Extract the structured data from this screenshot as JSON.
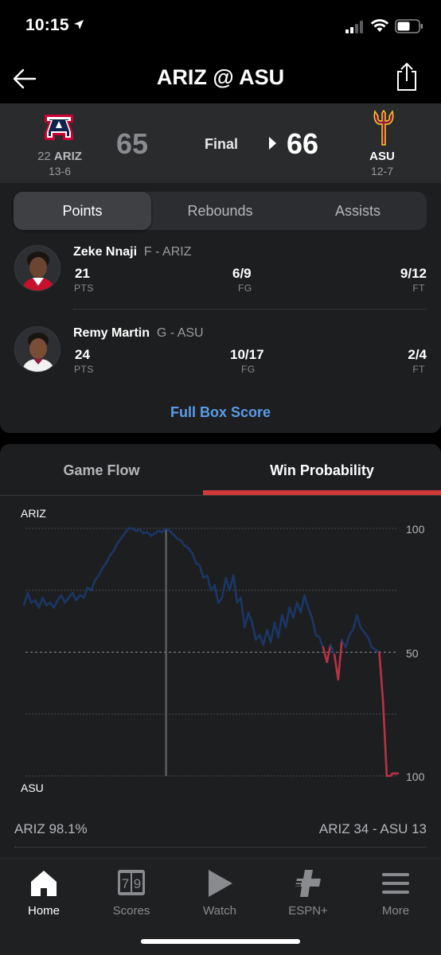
{
  "status_bar": {
    "time": "10:15"
  },
  "nav": {
    "title": "ARIZ @ ASU"
  },
  "game": {
    "away": {
      "rank": "22",
      "abbr": "ARIZ",
      "record": "13-6",
      "score": "65",
      "color": "#cc0033",
      "logo_color": "#0c234b"
    },
    "home": {
      "abbr": "ASU",
      "record": "12-7",
      "score": "66",
      "color": "#8c1d40",
      "logo_color": "#ffc627"
    },
    "status": "Final"
  },
  "leaders": {
    "tabs": [
      {
        "label": "Points",
        "active": true
      },
      {
        "label": "Rebounds",
        "active": false
      },
      {
        "label": "Assists",
        "active": false
      }
    ],
    "players": [
      {
        "name": "Zeke Nnaji",
        "meta": "F - ARIZ",
        "stats": [
          {
            "value": "21",
            "label": "PTS"
          },
          {
            "value": "6/9",
            "label": "FG"
          },
          {
            "value": "9/12",
            "label": "FT"
          }
        ]
      },
      {
        "name": "Remy Martin",
        "meta": "G - ASU",
        "stats": [
          {
            "value": "24",
            "label": "PTS"
          },
          {
            "value": "10/17",
            "label": "FG"
          },
          {
            "value": "2/4",
            "label": "FT"
          }
        ]
      }
    ],
    "full_box_score": "Full Box Score"
  },
  "flow": {
    "tabs": [
      {
        "label": "Game Flow",
        "active": false
      },
      {
        "label": "Win Probability",
        "active": true
      }
    ],
    "footer_left": "ARIZ 98.1%",
    "footer_right": "ARIZ 34  - ASU 13"
  },
  "chart_data": {
    "type": "line",
    "top_label": "ARIZ",
    "bottom_label": "ASU",
    "y_tick_labels": [
      "100",
      "50",
      "100"
    ],
    "ylim": [
      -100,
      100
    ],
    "y_meaning": "ARIZ win probability margin (positive = ARIZ favored)",
    "marker_fraction": 0.38,
    "series": [
      {
        "colors": {
          "ariz": "#1b3766",
          "asu": "#b83245"
        },
        "x": [
          0,
          0.01,
          0.02,
          0.03,
          0.04,
          0.05,
          0.06,
          0.07,
          0.08,
          0.09,
          0.1,
          0.11,
          0.12,
          0.13,
          0.14,
          0.15,
          0.16,
          0.17,
          0.18,
          0.19,
          0.2,
          0.21,
          0.22,
          0.23,
          0.24,
          0.25,
          0.26,
          0.27,
          0.28,
          0.29,
          0.3,
          0.31,
          0.32,
          0.33,
          0.34,
          0.35,
          0.36,
          0.37,
          0.38,
          0.39,
          0.4,
          0.41,
          0.42,
          0.43,
          0.44,
          0.45,
          0.46,
          0.47,
          0.48,
          0.49,
          0.5,
          0.51,
          0.52,
          0.53,
          0.54,
          0.55,
          0.56,
          0.57,
          0.58,
          0.59,
          0.6,
          0.61,
          0.62,
          0.63,
          0.64,
          0.65,
          0.66,
          0.67,
          0.68,
          0.69,
          0.7,
          0.71,
          0.72,
          0.73,
          0.74,
          0.75,
          0.76,
          0.77,
          0.78,
          0.79,
          0.8,
          0.81,
          0.82,
          0.83,
          0.84,
          0.85,
          0.86,
          0.87,
          0.88,
          0.89,
          0.9,
          0.91,
          0.92,
          0.93,
          0.94,
          0.95,
          0.96,
          0.97,
          0.98,
          0.985,
          0.99,
          0.995,
          1.0
        ],
        "values": [
          38,
          48,
          40,
          42,
          36,
          44,
          38,
          40,
          36,
          42,
          46,
          40,
          44,
          48,
          42,
          46,
          44,
          52,
          50,
          58,
          62,
          68,
          72,
          78,
          82,
          88,
          92,
          96,
          100,
          100,
          98,
          99,
          96,
          97,
          94,
          96,
          98,
          97,
          100,
          98,
          95,
          92,
          90,
          86,
          84,
          80,
          72,
          70,
          60,
          62,
          50,
          54,
          40,
          44,
          60,
          50,
          62,
          40,
          44,
          20,
          32,
          24,
          10,
          14,
          6,
          18,
          8,
          24,
          12,
          30,
          20,
          36,
          28,
          40,
          32,
          46,
          36,
          28,
          14,
          12,
          4,
          -8,
          6,
          -2,
          -22,
          10,
          4,
          14,
          18,
          30,
          20,
          16,
          12,
          4,
          2,
          0,
          -40,
          -100,
          -100,
          -98,
          -98,
          -98,
          -98
        ]
      }
    ]
  },
  "tab_bar": {
    "items": [
      {
        "label": "Home",
        "icon": "home-icon",
        "active": true
      },
      {
        "label": "Scores",
        "icon": "scores-icon",
        "active": false,
        "icon_text": "79"
      },
      {
        "label": "Watch",
        "icon": "play-icon",
        "active": false
      },
      {
        "label": "ESPN+",
        "icon": "espn-plus-icon",
        "active": false
      },
      {
        "label": "More",
        "icon": "menu-icon",
        "active": false
      }
    ]
  }
}
